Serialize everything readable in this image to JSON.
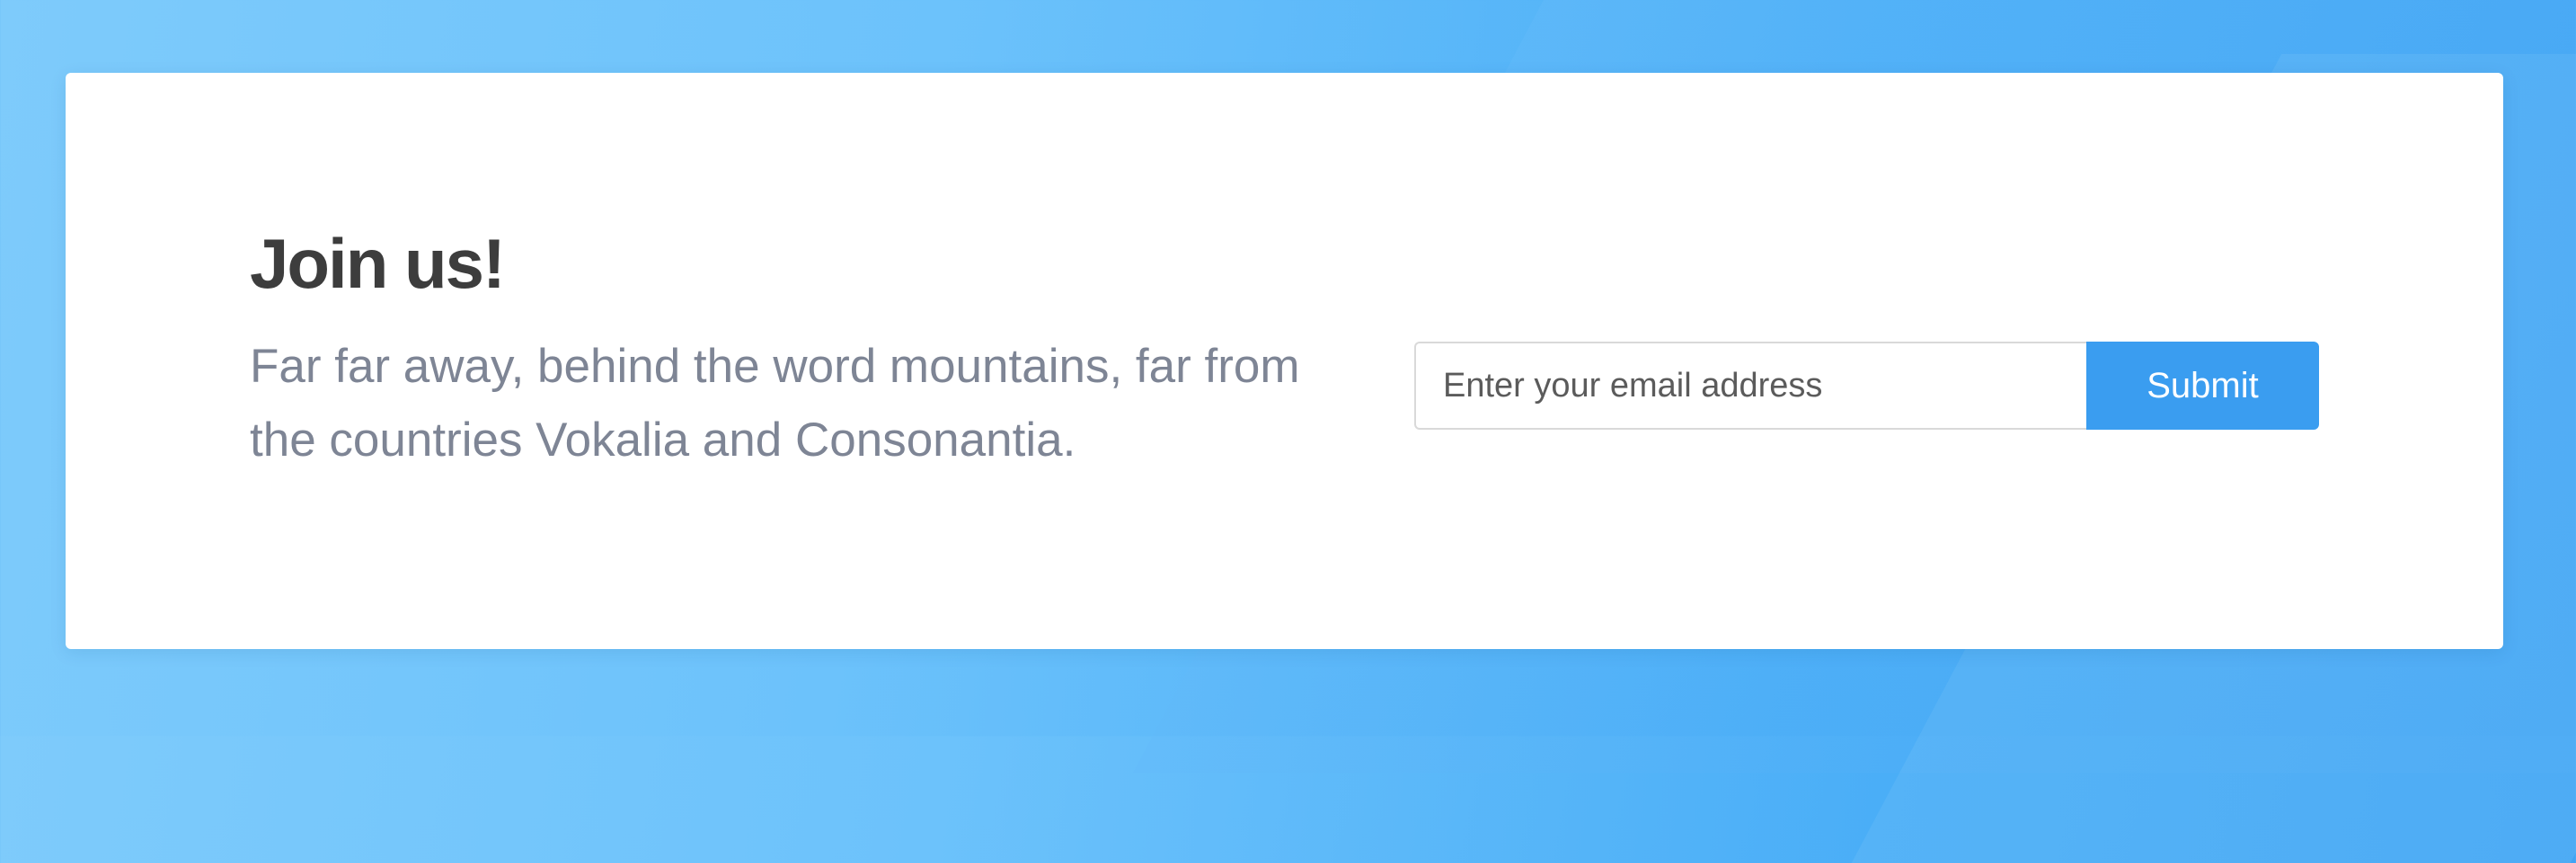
{
  "signup": {
    "title": "Join us!",
    "description": "Far far away, behind the word mountains, far from the countries Vokalia and Consonantia.",
    "email_placeholder": "Enter your email address",
    "email_value": "",
    "submit_label": "Submit"
  },
  "colors": {
    "background_gradient_start": "#7ecbfb",
    "background_gradient_end": "#3fa3f3",
    "card": "#ffffff",
    "title": "#3d3d3d",
    "description": "#7e8595",
    "button": "#3a9df0",
    "button_text": "#ffffff"
  }
}
